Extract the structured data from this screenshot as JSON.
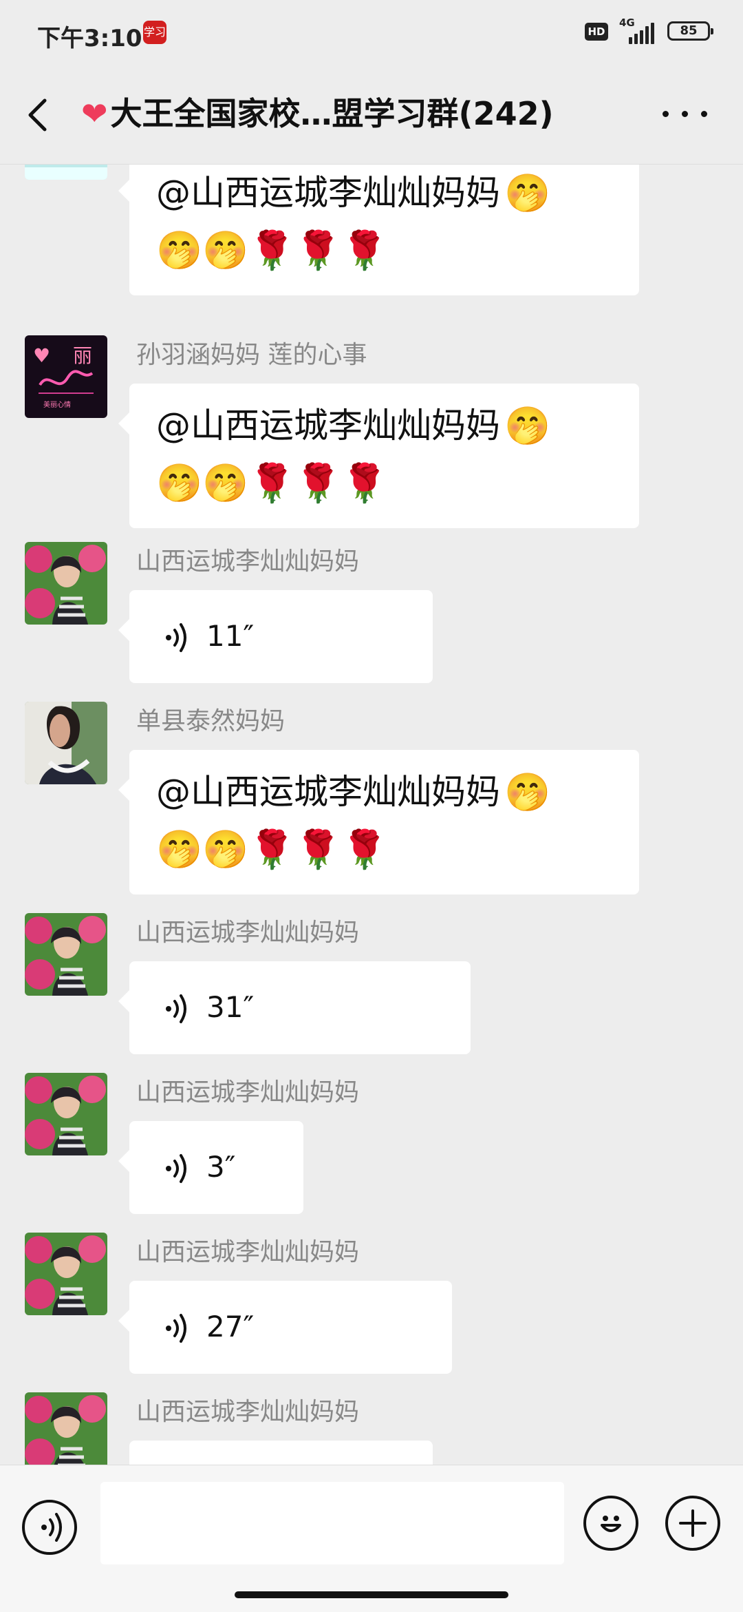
{
  "status_bar": {
    "time": "下午3:10",
    "app_badge": "学习",
    "hd": "HD",
    "network": "4G",
    "battery": "85"
  },
  "title_bar": {
    "icon": "heart-icon",
    "title": "大王全国家校…盟学习群(242)"
  },
  "messages": [
    {
      "avatar": "snowman-avatar",
      "sender": "",
      "line1": "@山西运城李灿灿妈妈",
      "line1_emoji": "🤭",
      "line2_emoji": "🤭🤭🌹🌹🌹"
    },
    {
      "avatar": "neon-li-avatar",
      "sender": "孙羽涵妈妈  莲的心事",
      "line1": "@山西运城李灿灿妈妈",
      "line1_emoji": "🤭",
      "line2_emoji": "🤭🤭🌹🌹🌹"
    },
    {
      "avatar": "flower-woman-avatar",
      "sender": "山西运城李灿灿妈妈",
      "voice_duration": "11″"
    },
    {
      "avatar": "profile-woman-avatar",
      "sender": "单县泰然妈妈",
      "line1": "@山西运城李灿灿妈妈",
      "line1_emoji": "🤭",
      "line2_emoji": "🤭🤭🌹🌹🌹"
    },
    {
      "avatar": "flower-woman-avatar",
      "sender": "山西运城李灿灿妈妈",
      "voice_duration": "31″"
    },
    {
      "avatar": "flower-woman-avatar",
      "sender": "山西运城李灿灿妈妈",
      "voice_duration": "3″"
    },
    {
      "avatar": "flower-woman-avatar",
      "sender": "山西运城李灿灿妈妈",
      "voice_duration": "27″"
    },
    {
      "avatar": "flower-woman-avatar",
      "sender": "山西运城李灿灿妈妈",
      "voice_duration": ""
    }
  ],
  "input_bar": {
    "voice_icon": "voice-icon",
    "emoji_icon": "emoji-icon",
    "plus_icon": "plus-icon",
    "input_value": ""
  },
  "colors": {
    "background": "#ededed",
    "bubble": "#ffffff",
    "sender": "#888888",
    "heart": "#ee3c5b"
  }
}
